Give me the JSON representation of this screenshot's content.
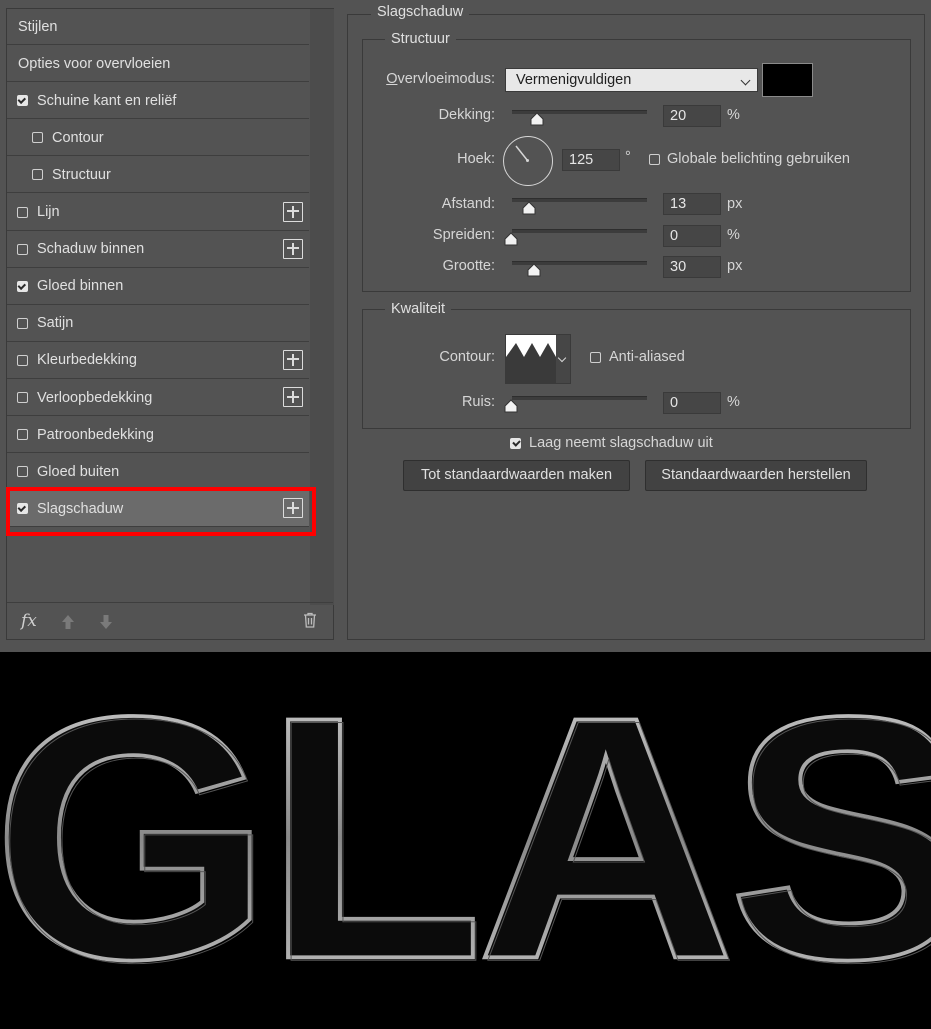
{
  "left_panel": {
    "items": [
      {
        "label": "Stijlen",
        "checkbox": false,
        "checked": false,
        "indent": false,
        "plus": false
      },
      {
        "label": "Opties voor overvloeien",
        "checkbox": false,
        "checked": false,
        "indent": false,
        "plus": false
      },
      {
        "label": "Schuine kant en reliëf",
        "checkbox": true,
        "checked": true,
        "indent": false,
        "plus": false
      },
      {
        "label": "Contour",
        "checkbox": true,
        "checked": false,
        "indent": true,
        "plus": false
      },
      {
        "label": "Structuur",
        "checkbox": true,
        "checked": false,
        "indent": true,
        "plus": false
      },
      {
        "label": "Lijn",
        "checkbox": true,
        "checked": false,
        "indent": false,
        "plus": true
      },
      {
        "label": "Schaduw binnen",
        "checkbox": true,
        "checked": false,
        "indent": false,
        "plus": true
      },
      {
        "label": "Gloed binnen",
        "checkbox": true,
        "checked": true,
        "indent": false,
        "plus": false
      },
      {
        "label": "Satijn",
        "checkbox": true,
        "checked": false,
        "indent": false,
        "plus": false
      },
      {
        "label": "Kleurbedekking",
        "checkbox": true,
        "checked": false,
        "indent": false,
        "plus": true
      },
      {
        "label": "Verloopbedekking",
        "checkbox": true,
        "checked": false,
        "indent": false,
        "plus": true
      },
      {
        "label": "Patroonbedekking",
        "checkbox": true,
        "checked": false,
        "indent": false,
        "plus": false
      },
      {
        "label": "Gloed buiten",
        "checkbox": true,
        "checked": false,
        "indent": false,
        "plus": false
      },
      {
        "label": "Slagschaduw",
        "checkbox": true,
        "checked": true,
        "indent": false,
        "plus": true,
        "selected": true
      }
    ],
    "fx_label": "fx"
  },
  "panel": {
    "title": "Slagschaduw",
    "structuur": {
      "title": "Structuur",
      "blend_label": "Overvloeimodus:",
      "blend_value": "Vermenigvuldigen",
      "shadow_color": "#000000",
      "opacity_label": "Dekking:",
      "opacity_value": "20",
      "opacity_unit": "%",
      "angle_label": "Hoek:",
      "angle_value": "125",
      "angle_unit": "°",
      "global_light_label": "Globale belichting gebruiken",
      "distance_label": "Afstand:",
      "distance_value": "13",
      "distance_unit": "px",
      "spread_label": "Spreiden:",
      "spread_value": "0",
      "spread_unit": "%",
      "size_label": "Grootte:",
      "size_value": "30",
      "size_unit": "px"
    },
    "kwaliteit": {
      "title": "Kwaliteit",
      "contour_label": "Contour:",
      "antialias_label": "Anti-aliased",
      "noise_label": "Ruis:",
      "noise_value": "0",
      "noise_unit": "%"
    },
    "knockout_label": "Laag neemt slagschaduw uit",
    "btn_default": "Tot standaardwaarden maken",
    "btn_reset": "Standaardwaarden herstellen"
  },
  "artwork": {
    "text": "GLAS"
  }
}
